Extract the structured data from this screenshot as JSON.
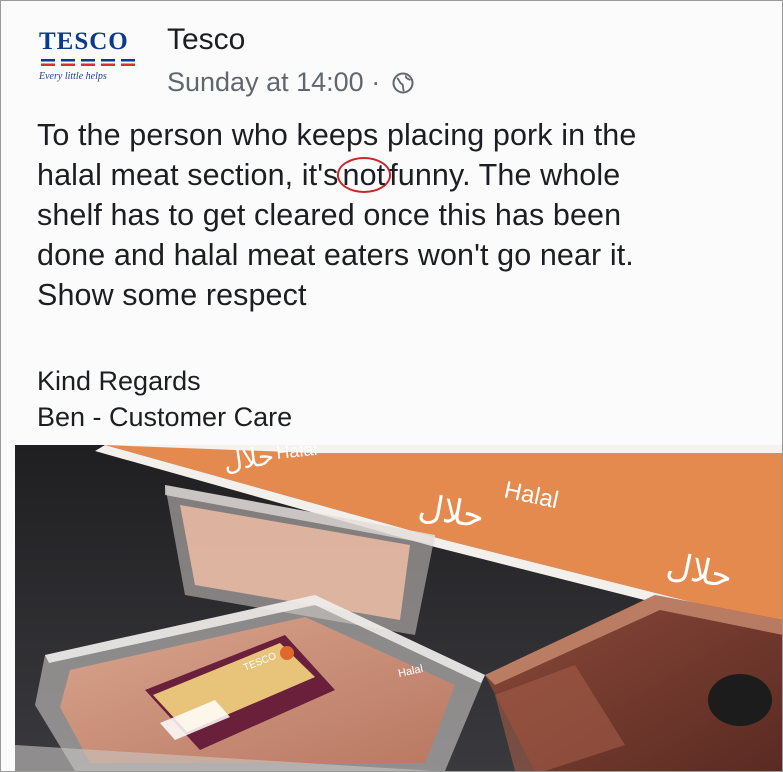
{
  "post": {
    "brand_logo": {
      "wordmark": "TESCO",
      "tagline": "Every little helps"
    },
    "page_name": "Tesco",
    "timestamp": "Sunday at 14:00",
    "separator": "·",
    "audience_icon": "globe-icon",
    "body_lines": [
      {
        "before": "To the person who keeps placing pork in the"
      },
      {
        "before": "halal meat section, it's",
        "circled": "not",
        "after": "funny. The whole"
      },
      {
        "before": "shelf has to get cleared once this has been"
      },
      {
        "before": "done and halal meat eaters won't go near it."
      },
      {
        "before": "Show some respect"
      }
    ],
    "signoff": [
      "Kind Regards",
      "Ben - Customer Care"
    ]
  },
  "photo": {
    "shelf_labels": [
      "Halal",
      "Halal"
    ],
    "arabic_labels": [
      "حلال",
      "حلال",
      "حلال"
    ],
    "tray_label": "Halal",
    "package_brand": "TESCO"
  },
  "colors": {
    "brand_blue": "#0a3a8c",
    "brand_red": "#e02b2b",
    "circle_red": "#c8262b",
    "meta_gray": "#606770",
    "shelf_orange": "#e58a4f"
  }
}
